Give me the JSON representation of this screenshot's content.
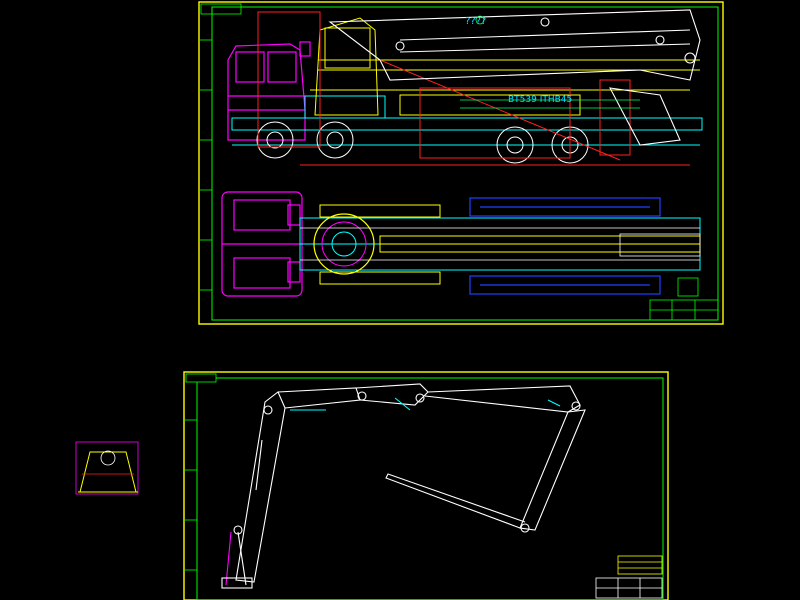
{
  "app": {
    "background": "#000000"
  },
  "sheets": {
    "top": {
      "labels": {
        "boom_question": "????",
        "model_code": "BT539 ITHB45"
      }
    },
    "bottom": {}
  },
  "colors": {
    "frame": "#ffff00",
    "border_green": "#00ff00",
    "cab": "#ff00ff",
    "chassis": "#00ffff",
    "boom": "#ffffff",
    "structure_yellow": "#ffff00",
    "hydraulic_red": "#ff2020",
    "outrigger_blue": "#2040ff",
    "text_green": "#00ff66",
    "label_cyan": "#00e5ff"
  },
  "icons": {
    "turret_icon": "turret-thumbnail"
  }
}
